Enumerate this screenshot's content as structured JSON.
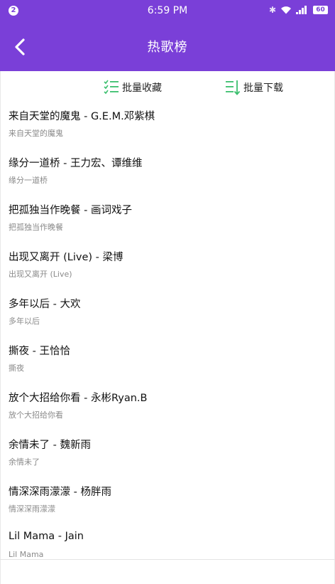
{
  "status_bar": {
    "notification_count": "2",
    "time": "6:59 PM",
    "battery": "60"
  },
  "header": {
    "title": "热歌榜"
  },
  "actions": {
    "favorite_label": "批量收藏",
    "download_label": "批量下载"
  },
  "colors": {
    "primary": "#7a3fd8",
    "accent_green": "#3bbf6e"
  },
  "songs": [
    {
      "title": "来自天堂的魔鬼 - G.E.M.邓紫棋",
      "subtitle": "来自天堂的魔鬼"
    },
    {
      "title": "缘分一道桥 - 王力宏、谭维维",
      "subtitle": "缘分一道桥"
    },
    {
      "title": "把孤独当作晚餐 - 画词戏子",
      "subtitle": "把孤独当作晚餐"
    },
    {
      "title": "出现又离开 (Live) - 梁博",
      "subtitle": "出现又离开 (Live)"
    },
    {
      "title": "多年以后 - 大欢",
      "subtitle": "多年以后"
    },
    {
      "title": "撕夜 - 王恰恰",
      "subtitle": "撕夜"
    },
    {
      "title": "放个大招给你看 - 永彬Ryan.B",
      "subtitle": "放个大招给你看"
    },
    {
      "title": "余情未了 - 魏新雨",
      "subtitle": "余情未了"
    },
    {
      "title": "情深深雨濛濛 - 杨胖雨",
      "subtitle": "情深深雨濛濛"
    },
    {
      "title": "Lil Mama - Jain",
      "subtitle": "Lil Mama"
    }
  ]
}
